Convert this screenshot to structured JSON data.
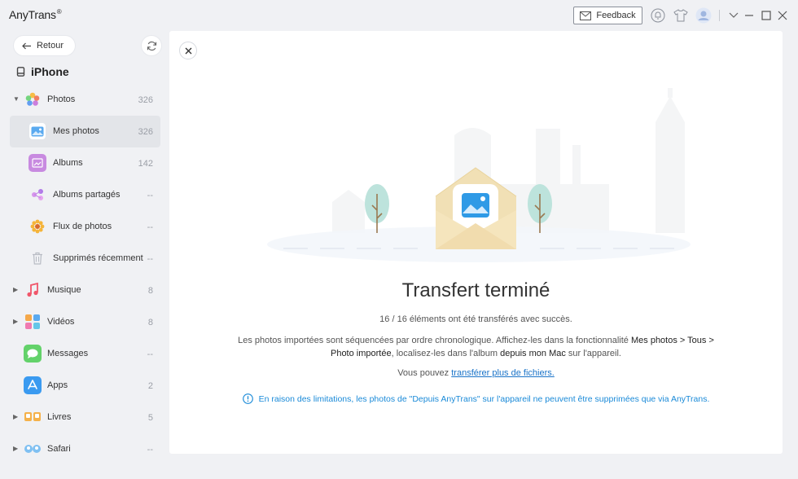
{
  "app": {
    "name": "AnyTrans",
    "trademark": "®",
    "feedback_label": "Feedback"
  },
  "sidebar": {
    "back_label": "Retour",
    "device_name": "iPhone",
    "items": [
      {
        "label": "Photos",
        "count": "326"
      },
      {
        "label": "Mes photos",
        "count": "326"
      },
      {
        "label": "Albums",
        "count": "142"
      },
      {
        "label": "Albums partagés",
        "count": "--"
      },
      {
        "label": "Flux de photos",
        "count": "--"
      },
      {
        "label": "Supprimés récemment",
        "count": "--"
      },
      {
        "label": "Musique",
        "count": "8"
      },
      {
        "label": "Vidéos",
        "count": "8"
      },
      {
        "label": "Messages",
        "count": "--"
      },
      {
        "label": "Apps",
        "count": "2"
      },
      {
        "label": "Livres",
        "count": "5"
      },
      {
        "label": "Safari",
        "count": "--"
      }
    ]
  },
  "main": {
    "title": "Transfert terminé",
    "subtitle": "16 / 16 éléments ont été transférés avec succès.",
    "desc_part1": "Les photos importées sont séquencées par ordre chronologique. Affichez-les dans la fonctionnalité ",
    "desc_bold1": "Mes photos > Tous > Photo importée",
    "desc_part2": ", localisez-les dans l'album ",
    "desc_bold2": "depuis mon Mac",
    "desc_part3": " sur l'appareil.",
    "more_prefix": "Vous pouvez ",
    "more_link": "transférer plus de fichiers.",
    "notice": "En raison des limitations, les photos de \"Depuis AnyTrans\" sur l'appareil ne peuvent être supprimées que via AnyTrans."
  },
  "colors": {
    "accent": "#1a8ad8",
    "link": "#1a73c8",
    "envelope": "#f1e0b5",
    "photo_tile": "#2f9ae6"
  }
}
